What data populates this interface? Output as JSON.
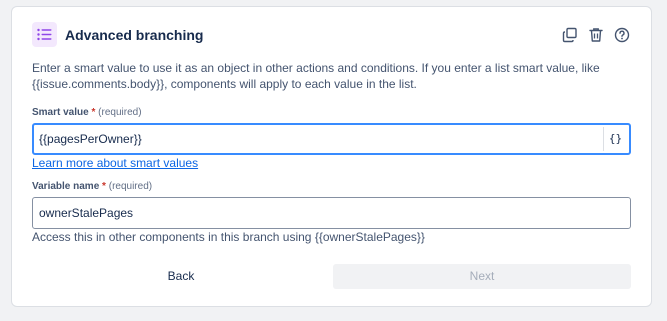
{
  "header": {
    "title": "Advanced branching",
    "icon": "list-icon",
    "accent_bg": "#f3e8fd",
    "accent_fg": "#8f46e8",
    "actions": [
      "copy-icon",
      "trash-icon",
      "help-icon"
    ]
  },
  "description": "Enter a smart value to use it as an object in other actions and conditions. If you enter a list smart value, like {{issue.comments.body}}, components will apply to each value in the list.",
  "smart_value": {
    "label": "Smart value",
    "required_mark": "*",
    "required_text": "(required)",
    "value": "{{pagesPerOwner}}",
    "braces_button": "{}",
    "learn_more": "Learn more about smart values"
  },
  "variable_name": {
    "label": "Variable name",
    "required_mark": "*",
    "required_text": "(required)",
    "value": "ownerStalePages",
    "hint": "Access this in other components in this branch using {{ownerStalePages}}"
  },
  "footer": {
    "back_label": "Back",
    "next_label": "Next"
  }
}
